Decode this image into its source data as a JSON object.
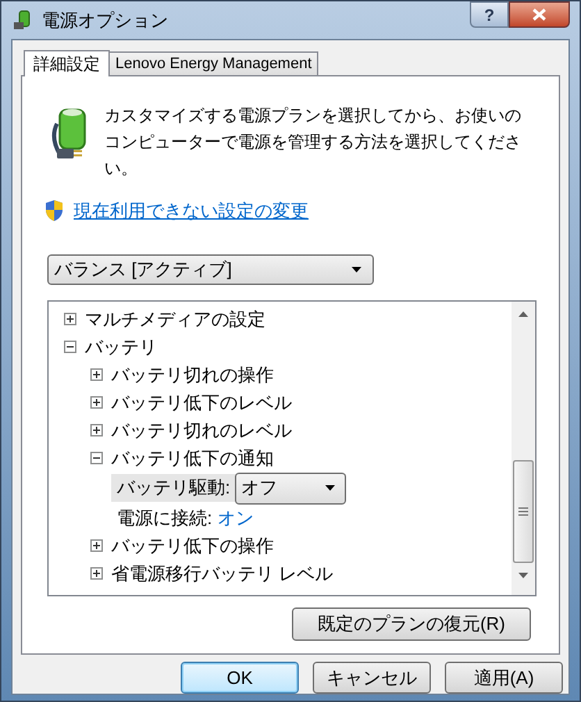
{
  "window": {
    "title": "電源オプション",
    "help": "?"
  },
  "tabs": [
    {
      "label": "詳細設定",
      "selected": true
    },
    {
      "label": "Lenovo Energy Management",
      "selected": false
    }
  ],
  "description": "カスタマイズする電源プランを選択してから、お使いのコンピューターで電源を管理する方法を選択してください。",
  "link": "現在利用できない設定の変更",
  "plan_select": {
    "value": "バランス [アクティブ]"
  },
  "tree": [
    {
      "kind": "node",
      "label": "マルチメディアの設定",
      "expanded": false
    },
    {
      "kind": "node",
      "label": "バッテリ",
      "expanded": true,
      "children": [
        {
          "kind": "node",
          "label": "バッテリ切れの操作",
          "expanded": false
        },
        {
          "kind": "node",
          "label": "バッテリ低下のレベル",
          "expanded": false
        },
        {
          "kind": "node",
          "label": "バッテリ切れのレベル",
          "expanded": false
        },
        {
          "kind": "node",
          "label": "バッテリ低下の通知",
          "expanded": true,
          "children": [
            {
              "kind": "dropdown",
              "label": "バッテリ駆動:",
              "value": "オフ",
              "selected": true
            },
            {
              "kind": "value",
              "label": "電源に接続:",
              "value": "オン",
              "selected": false
            }
          ]
        },
        {
          "kind": "node",
          "label": "バッテリ低下の操作",
          "expanded": false
        },
        {
          "kind": "node",
          "label": "省電源移行バッテリ レベル",
          "expanded": false
        }
      ]
    }
  ],
  "restore_button": "既定のプランの復元(R)",
  "buttons": [
    {
      "label": "OK",
      "default": true
    },
    {
      "label": "キャンセル",
      "default": false
    },
    {
      "label": "適用(A)",
      "default": false
    }
  ]
}
